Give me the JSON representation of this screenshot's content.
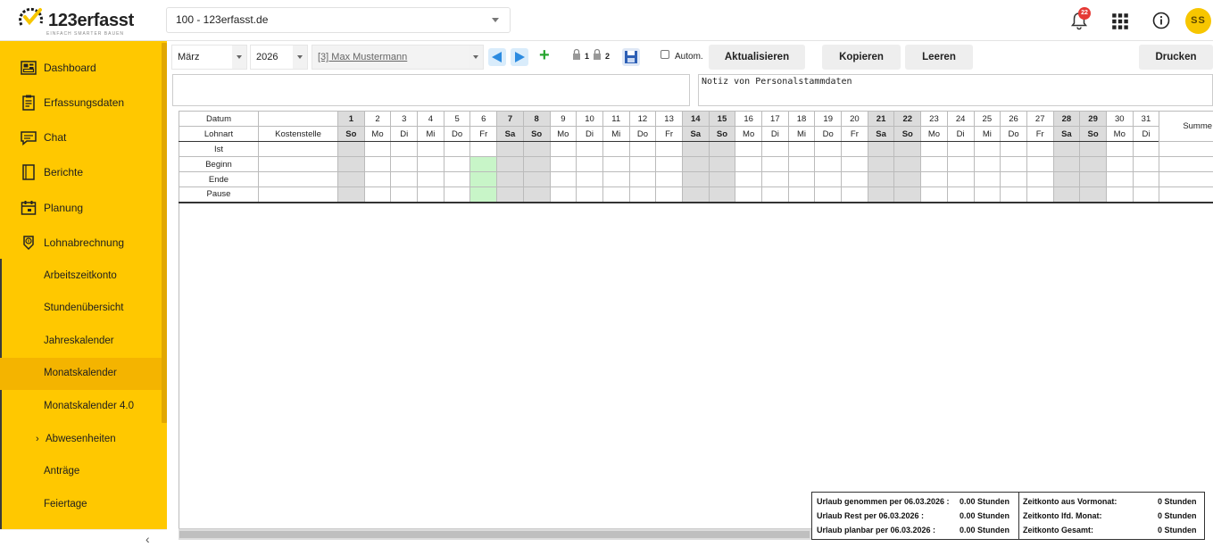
{
  "header": {
    "logo_text": "123erfasst",
    "logo_tagline": "EINFACH SMARTER BAUEN",
    "company_select": "100 - 123erfasst.de",
    "notification_count": "22",
    "user_initials": "SS"
  },
  "sidebar": {
    "items": [
      {
        "label": "Dashboard",
        "icon": "dashboard-icon"
      },
      {
        "label": "Erfassungsdaten",
        "icon": "clipboard-icon"
      },
      {
        "label": "Chat",
        "icon": "chat-icon"
      },
      {
        "label": "Berichte",
        "icon": "report-icon"
      },
      {
        "label": "Planung",
        "icon": "calendar-icon"
      },
      {
        "label": "Lohnabrechnung",
        "icon": "payroll-icon"
      }
    ],
    "subitems": [
      {
        "label": "Arbeitszeitkonto"
      },
      {
        "label": "Stundenübersicht"
      },
      {
        "label": "Jahreskalender"
      },
      {
        "label": "Monatskalender",
        "active": true
      },
      {
        "label": "Monatskalender 4.0"
      },
      {
        "label": "Abwesenheiten",
        "has_children": true
      },
      {
        "label": "Anträge"
      },
      {
        "label": "Feiertage"
      }
    ]
  },
  "toolbar": {
    "month": "März",
    "year": "2026",
    "employee": "[3] Max Mustermann",
    "lock1": "1",
    "lock2": "2",
    "auto_label": "Autom.",
    "refresh_label": "Aktualisieren",
    "copy_label": "Kopieren",
    "clear_label": "Leeren",
    "print_label": "Drucken"
  },
  "note_right": "Notiz von Personalstammdaten",
  "calendar": {
    "header_datum": "Datum",
    "header_lohnart": "Lohnart",
    "header_kostenstelle": "Kostenstelle",
    "header_summe": "Summe",
    "rows": [
      "Ist",
      "Beginn",
      "Ende",
      "Pause"
    ],
    "days": [
      {
        "d": "1",
        "w": "So"
      },
      {
        "d": "2",
        "w": "Mo"
      },
      {
        "d": "3",
        "w": "Di"
      },
      {
        "d": "4",
        "w": "Mi"
      },
      {
        "d": "5",
        "w": "Do"
      },
      {
        "d": "6",
        "w": "Fr"
      },
      {
        "d": "7",
        "w": "Sa"
      },
      {
        "d": "8",
        "w": "So"
      },
      {
        "d": "9",
        "w": "Mo"
      },
      {
        "d": "10",
        "w": "Di"
      },
      {
        "d": "11",
        "w": "Mi"
      },
      {
        "d": "12",
        "w": "Do"
      },
      {
        "d": "13",
        "w": "Fr"
      },
      {
        "d": "14",
        "w": "Sa"
      },
      {
        "d": "15",
        "w": "So"
      },
      {
        "d": "16",
        "w": "Mo"
      },
      {
        "d": "17",
        "w": "Di"
      },
      {
        "d": "18",
        "w": "Mi"
      },
      {
        "d": "19",
        "w": "Do"
      },
      {
        "d": "20",
        "w": "Fr"
      },
      {
        "d": "21",
        "w": "Sa"
      },
      {
        "d": "22",
        "w": "So"
      },
      {
        "d": "23",
        "w": "Mo"
      },
      {
        "d": "24",
        "w": "Di"
      },
      {
        "d": "25",
        "w": "Mi"
      },
      {
        "d": "26",
        "w": "Do"
      },
      {
        "d": "27",
        "w": "Fr"
      },
      {
        "d": "28",
        "w": "Sa"
      },
      {
        "d": "29",
        "w": "So"
      },
      {
        "d": "30",
        "w": "Mo"
      },
      {
        "d": "31",
        "w": "Di"
      }
    ],
    "today": "6"
  },
  "summary": {
    "left": [
      {
        "label": "Urlaub genommen per 06.03.2026 :",
        "value": "0.00 Stunden"
      },
      {
        "label": "Urlaub Rest per 06.03.2026 :",
        "value": "0.00 Stunden"
      },
      {
        "label": "Urlaub planbar per 06.03.2026 :",
        "value": "0.00 Stunden"
      }
    ],
    "right": [
      {
        "label": "Zeitkonto aus Vormonat:",
        "value": "0 Stunden"
      },
      {
        "label": "Zeitkonto lfd. Monat:",
        "value": "0 Stunden"
      },
      {
        "label": "Zeitkonto Gesamt:",
        "value": "0 Stunden"
      }
    ]
  },
  "colors": {
    "sidebar_bg": "#ffc800",
    "sidebar_active": "#f4b400",
    "weekend": "#dcdcdc",
    "today": "#c8f5c8",
    "accent_green": "#27a52f",
    "badge_red": "#e53935"
  }
}
